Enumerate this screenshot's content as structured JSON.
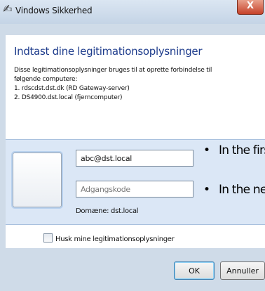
{
  "window": {
    "title": "Vindows Sikkerhed",
    "close_label": "X"
  },
  "main": {
    "heading": "Indtast dine legitimationsoplysninger",
    "description_lines": [
      "Disse legitimationsoplysninger bruges til at oprette forbindelse til",
      "følgende computere:",
      "1. rdscdst.dst.dk (RD Gateway-server)",
      "2. DS4900.dst.local (fjerncomputer)"
    ]
  },
  "credentials": {
    "username_value": "abc@dst.local",
    "password_placeholder": "Adgangskode",
    "domain_text": "Domæne: dst.local"
  },
  "overlay_bullets": [
    {
      "bullet": "•",
      "text": "In the first"
    },
    {
      "bullet": "•",
      "text": "In the nex"
    }
  ],
  "remember": {
    "label": "Husk mine legitimationsoplysninger",
    "checked": false
  },
  "buttons": {
    "ok_label": "OK",
    "cancel_label": "Annuller"
  }
}
